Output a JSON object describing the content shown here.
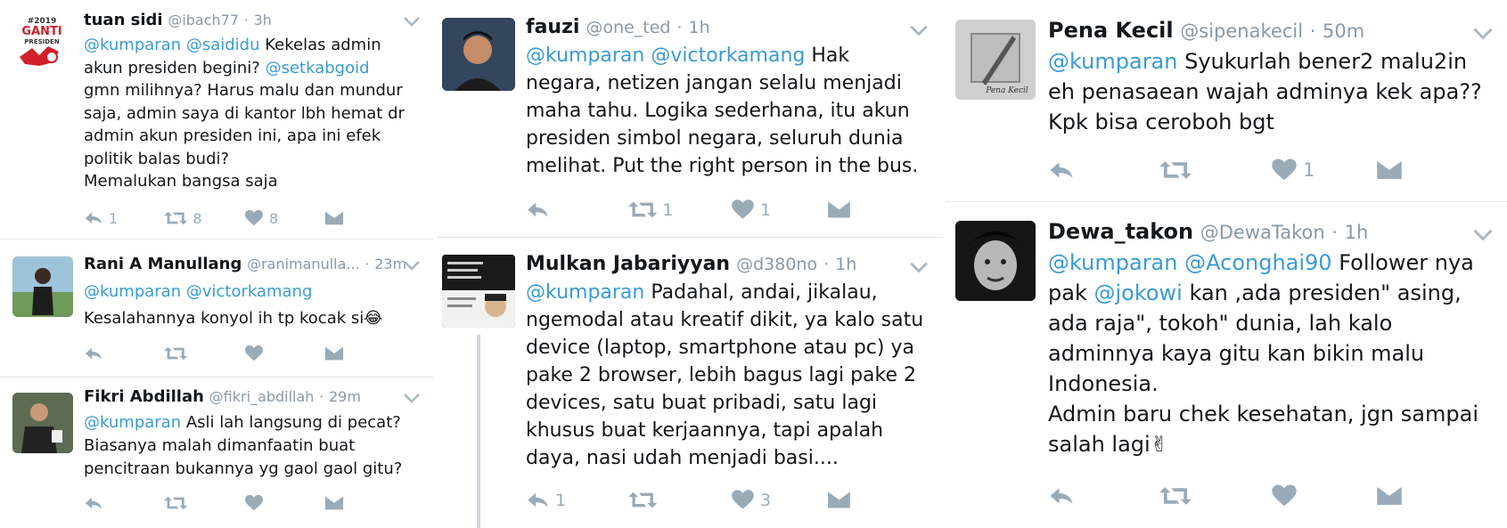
{
  "colors": {
    "mention": "#3a9bd5",
    "muted": "#8899a6",
    "icon": "#9aabb8",
    "divider": "#e1e8ed"
  },
  "columns": [
    {
      "tweets": [
        {
          "name": "tuan sidi",
          "handle": "@ibach77",
          "time": "3h",
          "lines": [
            [
              {
                "t": "@kumparan",
                "m": true
              },
              {
                "t": " "
              },
              {
                "t": "@saididu",
                "m": true
              },
              {
                "t": " Kekelas admin"
              }
            ],
            [
              {
                "t": "akun presiden begini? "
              },
              {
                "t": "@setkabgoid",
                "m": true
              }
            ],
            [
              {
                "t": "gmn milihnya? Harus malu dan mundur"
              }
            ],
            [
              {
                "t": "saja, admin saya di kantor lbh hemat dr"
              }
            ],
            [
              {
                "t": "admin akun presiden ini, apa ini efek"
              }
            ],
            [
              {
                "t": "politik balas budi?"
              }
            ],
            [
              {
                "t": "Memalukan bangsa saja"
              }
            ]
          ],
          "counts": {
            "reply": "1",
            "retweet": "8",
            "like": "8"
          }
        },
        {
          "name": "Rani A Manullang",
          "handle": "@ranimanulla...",
          "time": "23m",
          "lines": [
            [
              {
                "t": "@kumparan",
                "m": true
              },
              {
                "t": " "
              },
              {
                "t": "@victorkamang",
                "m": true
              }
            ],
            [
              {
                "t": "Kesalahannya konyol ih tp kocak si"
              },
              {
                "t": "😂",
                "e": true
              }
            ]
          ],
          "counts": {
            "reply": "",
            "retweet": "",
            "like": ""
          }
        },
        {
          "name": "Fikri Abdillah",
          "handle": "@fikri_abdillah",
          "time": "29m",
          "lines": [
            [
              {
                "t": "@kumparan",
                "m": true
              },
              {
                "t": " Asli lah langsung di pecat?"
              }
            ],
            [
              {
                "t": "Biasanya malah dimanfaatin buat"
              }
            ],
            [
              {
                "t": "pencitraan bukannya yg gaol gaol gitu?"
              }
            ]
          ],
          "counts": {
            "reply": "",
            "retweet": "",
            "like": ""
          }
        }
      ]
    },
    {
      "tweets": [
        {
          "name": "fauzi",
          "handle": "@one_ted",
          "time": "1h",
          "lines": [
            [
              {
                "t": "@kumparan",
                "m": true
              },
              {
                "t": " "
              },
              {
                "t": "@victorkamang",
                "m": true
              },
              {
                "t": " Hak"
              }
            ],
            [
              {
                "t": "negara, netizen jangan selalu menjadi"
              }
            ],
            [
              {
                "t": "maha tahu. Logika sederhana, itu akun"
              }
            ],
            [
              {
                "t": "presiden simbol negara, seluruh dunia"
              }
            ],
            [
              {
                "t": "melihat. Put the right person in the bus."
              }
            ]
          ],
          "counts": {
            "reply": "",
            "retweet": "1",
            "like": "1"
          }
        },
        {
          "name": "Mulkan Jabariyyan",
          "handle": "@d380no",
          "time": "1h",
          "lines": [
            [
              {
                "t": "@kumparan",
                "m": true
              },
              {
                "t": " Padahal, andai, jikalau,"
              }
            ],
            [
              {
                "t": "ngemodal atau kreatif dikit, ya kalo satu"
              }
            ],
            [
              {
                "t": "device (laptop, smartphone atau pc) ya"
              }
            ],
            [
              {
                "t": "pake 2 browser, lebih bagus lagi pake 2"
              }
            ],
            [
              {
                "t": "devices, satu buat pribadi, satu lagi"
              }
            ],
            [
              {
                "t": "khusus buat kerjaannya, tapi apalah"
              }
            ],
            [
              {
                "t": "daya, nasi udah menjadi basi...."
              }
            ]
          ],
          "counts": {
            "reply": "1",
            "retweet": "",
            "like": "3"
          }
        }
      ]
    },
    {
      "tweets": [
        {
          "name": "Pena Kecil",
          "handle": "@sipenakecil",
          "time": "50m",
          "avatar_text": "Pena Kecil",
          "lines": [
            [
              {
                "t": "@kumparan",
                "m": true
              },
              {
                "t": " Syukurlah bener2 malu2in"
              }
            ],
            [
              {
                "t": "eh penasaean wajah adminya kek apa??"
              }
            ],
            [
              {
                "t": "Kpk bisa ceroboh bgt"
              }
            ]
          ],
          "counts": {
            "reply": "",
            "retweet": "",
            "like": "1"
          }
        },
        {
          "name": "Dewa_takon",
          "handle": "@DewaTakon",
          "time": "1h",
          "lines": [
            [
              {
                "t": "@kumparan",
                "m": true
              },
              {
                "t": " "
              },
              {
                "t": "@Aconghai90",
                "m": true
              },
              {
                "t": " Follower nya"
              }
            ],
            [
              {
                "t": "pak "
              },
              {
                "t": "@jokowi",
                "m": true
              },
              {
                "t": " kan ,ada presiden\" asing,"
              }
            ],
            [
              {
                "t": "ada raja\", tokoh\" dunia, lah kalo"
              }
            ],
            [
              {
                "t": "adminnya kaya gitu kan bikin malu"
              }
            ],
            [
              {
                "t": "Indonesia."
              }
            ],
            [
              {
                "t": "Admin baru chek kesehatan, jgn sampai"
              }
            ],
            [
              {
                "t": "salah lagi"
              },
              {
                "t": "✌",
                "e": true
              }
            ]
          ],
          "counts": {
            "reply": "",
            "retweet": "",
            "like": ""
          }
        }
      ]
    }
  ]
}
